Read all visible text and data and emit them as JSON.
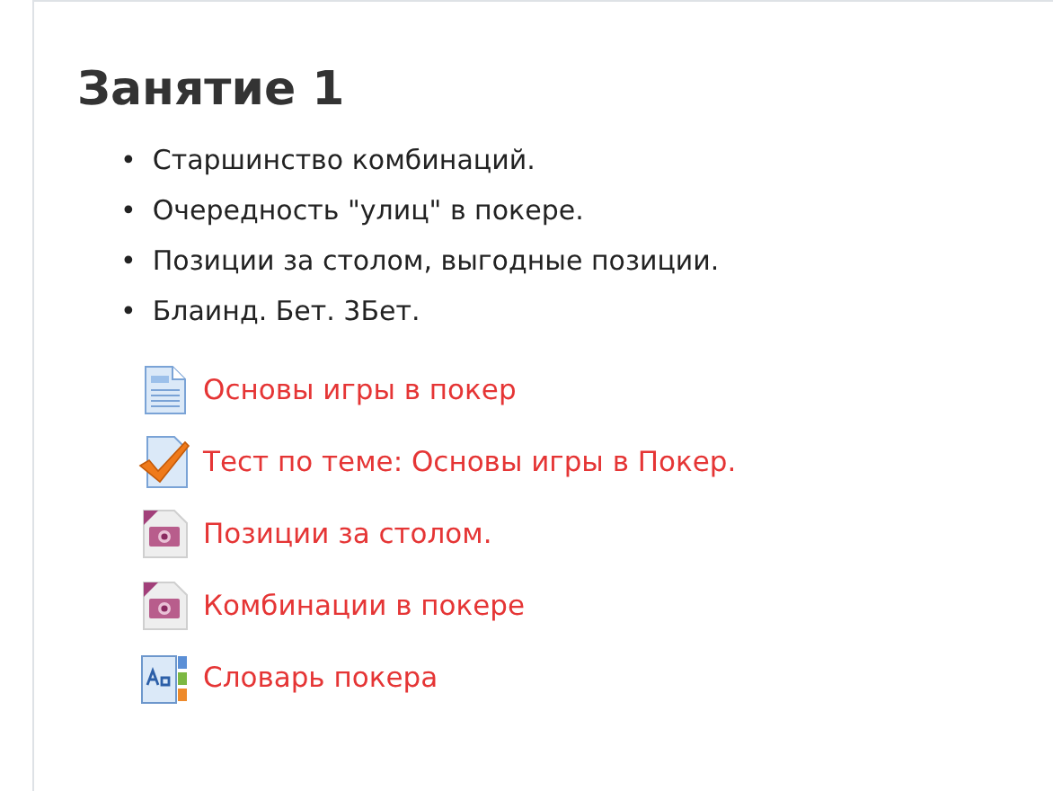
{
  "section": {
    "title": "Занятие 1",
    "summary": [
      {
        "marker": "•",
        "text": "Старшинство комбинаций."
      },
      {
        "marker": "•",
        "text": "Очередность \"улиц\" в покере."
      },
      {
        "marker": "•",
        "text": "Позиции за столом, выгодные позиции."
      },
      {
        "marker": "•",
        "text": "Блаинд. Бет. 3Бет."
      }
    ],
    "activities": [
      {
        "kind": "page",
        "label": "Основы игры в покер"
      },
      {
        "kind": "quiz",
        "label": "Тест по теме: Основы игры в Покер."
      },
      {
        "kind": "image",
        "label": "Позиции за столом."
      },
      {
        "kind": "image",
        "label": "Комбинации в покере"
      },
      {
        "kind": "glossary",
        "label": "Словарь покера"
      }
    ]
  }
}
